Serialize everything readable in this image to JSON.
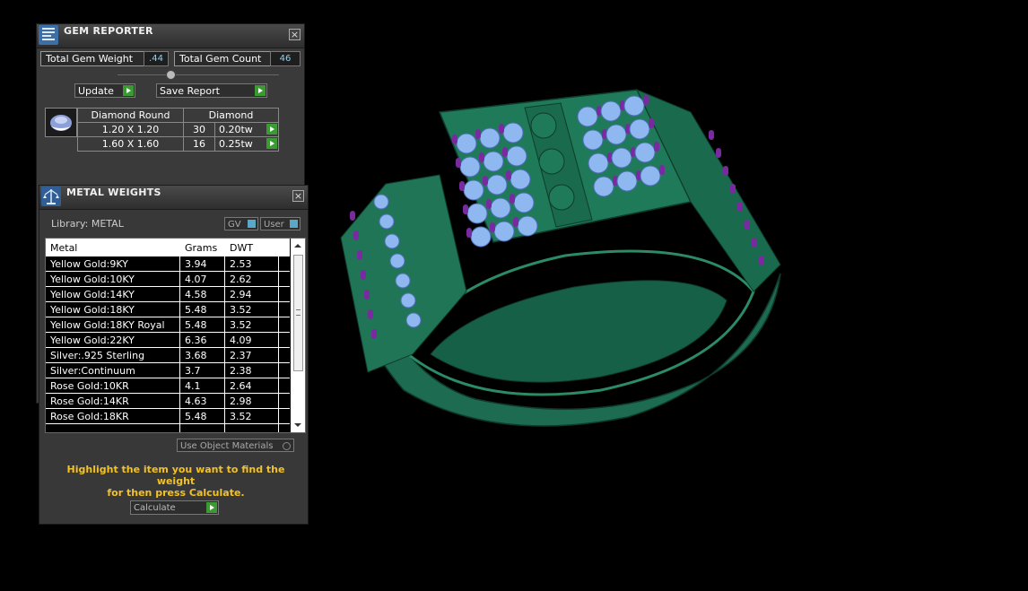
{
  "gem_reporter": {
    "title": "GEM REPORTER",
    "close": "×",
    "total_gem_weight_label": "Total Gem Weight",
    "total_gem_weight_value": ".44",
    "total_gem_count_label": "Total Gem Count",
    "total_gem_count_value": "46",
    "update_label": "Update",
    "save_report_label": "Save Report",
    "table": {
      "shape": "Diamond Round",
      "stone": "Diamond",
      "rows": [
        {
          "size": "1.20 X 1.20",
          "count": "30",
          "weight": "0.20tw"
        },
        {
          "size": "1.60 X 1.60",
          "count": "16",
          "weight": "0.25tw"
        }
      ]
    }
  },
  "metal_weights": {
    "title": "METAL WEIGHTS",
    "close": "×",
    "library_label": "Library: METAL",
    "gv_label": "GV",
    "user_label": "User",
    "columns": [
      "Metal",
      "Grams",
      "DWT"
    ],
    "rows": [
      {
        "metal": "Yellow Gold:9KY",
        "grams": "3.94",
        "dwt": "2.53"
      },
      {
        "metal": "Yellow Gold:10KY",
        "grams": "4.07",
        "dwt": "2.62"
      },
      {
        "metal": "Yellow Gold:14KY",
        "grams": "4.58",
        "dwt": "2.94"
      },
      {
        "metal": "Yellow Gold:18KY",
        "grams": "5.48",
        "dwt": "3.52"
      },
      {
        "metal": "Yellow Gold:18KY Royal",
        "grams": "5.48",
        "dwt": "3.52"
      },
      {
        "metal": "Yellow Gold:22KY",
        "grams": "6.36",
        "dwt": "4.09"
      },
      {
        "metal": "Silver:.925 Sterling",
        "grams": "3.68",
        "dwt": "2.37"
      },
      {
        "metal": "Silver:Continuum",
        "grams": "3.7",
        "dwt": "2.38"
      },
      {
        "metal": "Rose Gold:10KR",
        "grams": "4.1",
        "dwt": "2.64"
      },
      {
        "metal": "Rose Gold:14KR",
        "grams": "4.63",
        "dwt": "2.98"
      },
      {
        "metal": "Rose Gold:18KR",
        "grams": "5.48",
        "dwt": "3.52"
      }
    ],
    "use_object_materials_label": "Use Object Materials",
    "hint_line1": "Highlight the item you want to find the weight",
    "hint_line2": "for then press Calculate.",
    "calculate_label": "Calculate"
  },
  "colors": {
    "ring_metal": "#1f7a5a",
    "diamond": "#8fb8f0",
    "prong": "#7a2aa0",
    "accent_go": "#3b9b32",
    "hint": "#f2c226"
  }
}
